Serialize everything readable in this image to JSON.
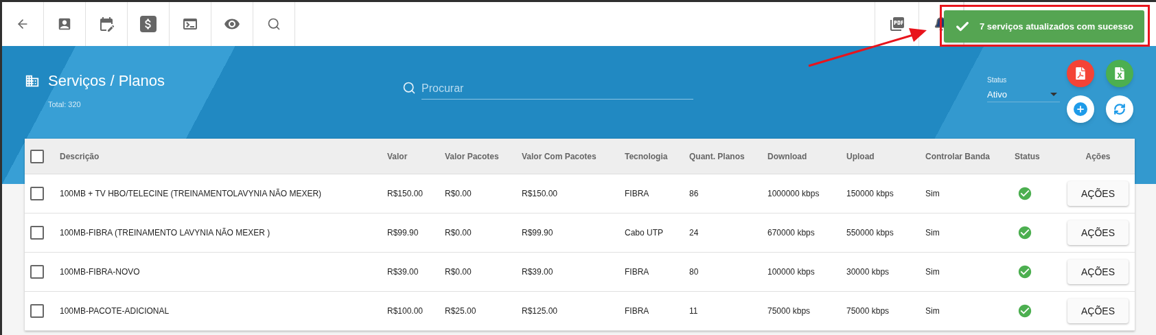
{
  "page": {
    "title": "Serviços / Planos",
    "total": "Total: 320"
  },
  "search": {
    "placeholder": "Procurar"
  },
  "status_filter": {
    "label": "Status",
    "value": "Ativo"
  },
  "toast": {
    "message": "7 serviços atualizados com sucesso"
  },
  "table": {
    "select_all": {
      "checked": false
    },
    "columns": [
      "Descrição",
      "Valor",
      "Valor Pacotes",
      "Valor Com Pacotes",
      "Tecnologia",
      "Quant. Planos",
      "Download",
      "Upload",
      "Controlar Banda",
      "Status",
      "Ações"
    ],
    "rows": [
      {
        "checked": false,
        "cells": [
          "100MB + TV HBO/TELECINE (TREINAMENTOLAVYNIA NÃO MEXER)",
          "R$150.00",
          "R$0.00",
          "R$150.00",
          "FIBRA",
          "86",
          "1000000 kbps",
          "150000 kbps",
          "Sim"
        ],
        "active": true,
        "action": "AÇÕES"
      },
      {
        "checked": false,
        "cells": [
          "100MB-FIBRA (TREINAMENTO LAVYNIA NÃO MEXER )",
          "R$99.90",
          "R$0.00",
          "R$99.90",
          "Cabo UTP",
          "24",
          "670000 kbps",
          "550000 kbps",
          "Sim"
        ],
        "active": true,
        "action": "AÇÕES"
      },
      {
        "checked": false,
        "cells": [
          "100MB-FIBRA-NOVO",
          "R$39.00",
          "R$0.00",
          "R$39.00",
          "FIBRA",
          "80",
          "100000 kbps",
          "30000 kbps",
          "Sim"
        ],
        "active": true,
        "action": "AÇÕES"
      },
      {
        "checked": false,
        "cells": [
          "100MB-PACOTE-ADICIONAL",
          "R$100.00",
          "R$25.00",
          "R$125.00",
          "FIBRA",
          "11",
          "75000 kbps",
          "75000 kbps",
          "Sim"
        ],
        "active": true,
        "action": "AÇÕES"
      }
    ]
  }
}
